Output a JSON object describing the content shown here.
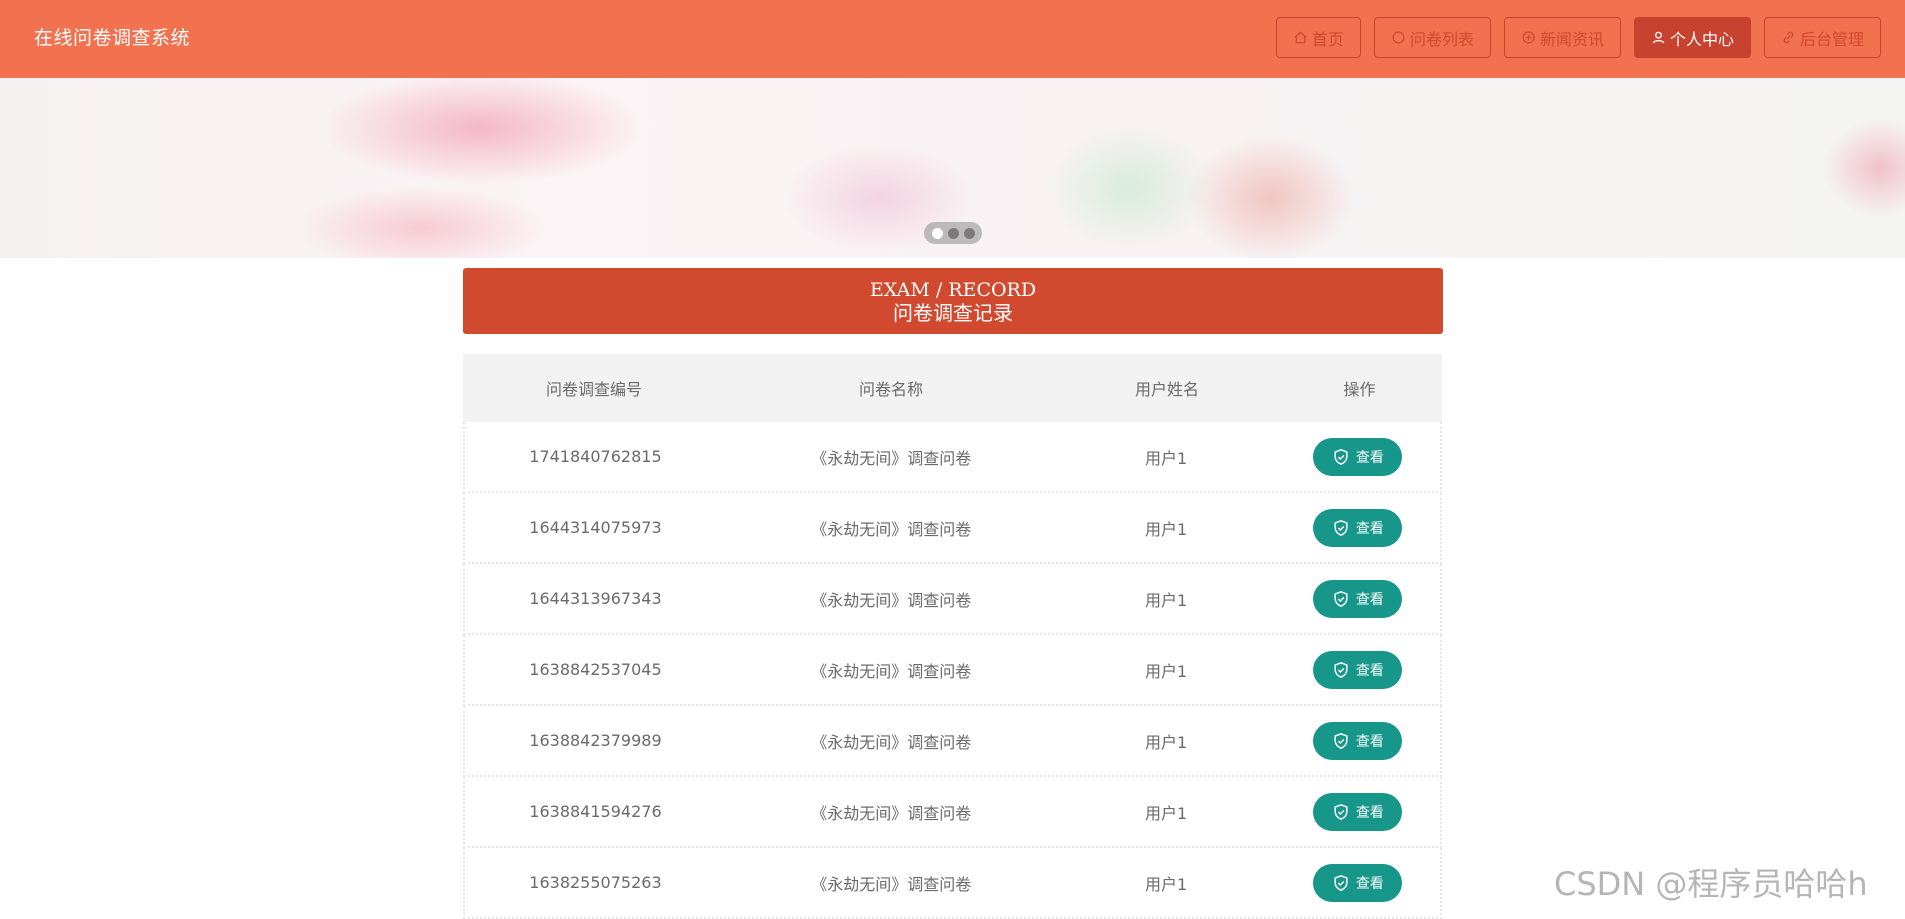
{
  "header": {
    "brand": "在线问卷调查系统",
    "nav": [
      {
        "label": "首页",
        "icon": "home-icon",
        "active": false
      },
      {
        "label": "问卷列表",
        "icon": "circle-icon",
        "active": false
      },
      {
        "label": "新闻资讯",
        "icon": "news-icon",
        "active": false
      },
      {
        "label": "个人中心",
        "icon": "user-icon",
        "active": true
      },
      {
        "label": "后台管理",
        "icon": "link-icon",
        "active": false
      }
    ]
  },
  "banner": {
    "slides": 3,
    "active_slide": 1
  },
  "section": {
    "title_en": "EXAM / RECORD",
    "title_cn": "问卷调查记录"
  },
  "table": {
    "headers": [
      "问卷调查编号",
      "问卷名称",
      "用户姓名",
      "操作"
    ],
    "rows": [
      {
        "id": "1741840762815",
        "name": "《永劫无间》调查问卷",
        "user": "用户1",
        "action": "查看"
      },
      {
        "id": "1644314075973",
        "name": "《永劫无间》调查问卷",
        "user": "用户1",
        "action": "查看"
      },
      {
        "id": "1644313967343",
        "name": "《永劫无间》调查问卷",
        "user": "用户1",
        "action": "查看"
      },
      {
        "id": "1638842537045",
        "name": "《永劫无间》调查问卷",
        "user": "用户1",
        "action": "查看"
      },
      {
        "id": "1638842379989",
        "name": "《永劫无间》调查问卷",
        "user": "用户1",
        "action": "查看"
      },
      {
        "id": "1638841594276",
        "name": "《永劫无间》调查问卷",
        "user": "用户1",
        "action": "查看"
      },
      {
        "id": "1638255075263",
        "name": "《永劫无间》调查问卷",
        "user": "用户1",
        "action": "查看"
      }
    ]
  },
  "watermark": "CSDN @程序员哈哈h",
  "colors": {
    "header_bg": "#F2714F",
    "nav_active_bg": "#C8432F",
    "title_bg": "#D14A30",
    "view_button_bg": "#17968A"
  }
}
